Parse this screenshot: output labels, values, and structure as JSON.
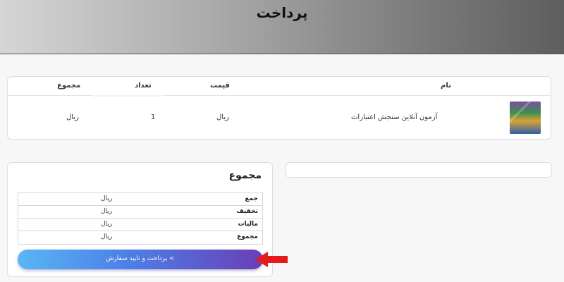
{
  "header": {
    "title": "پرداخت"
  },
  "cart": {
    "columns": {
      "name": "نام",
      "price": "قیمت",
      "qty": "تعداد",
      "total": "مجموع"
    },
    "items": [
      {
        "name": "آزمون آنلاین سنجش اعتبارات",
        "price": "ریال",
        "qty": "1",
        "total": "ریال"
      }
    ]
  },
  "totals": {
    "title": "مجموع",
    "rows": [
      {
        "label": "جمع",
        "value": "ریال"
      },
      {
        "label": "تخفیف",
        "value": "ریال"
      },
      {
        "label": "مالیات",
        "value": "ریال"
      },
      {
        "label": "مجموع",
        "value": "ریال"
      }
    ],
    "pay_button_label": "پرداخت و تایید سفارش  <"
  },
  "colors": {
    "button_start": "#58b6f5",
    "button_end": "#6a3fb6",
    "arrow": "#e31b1b"
  }
}
